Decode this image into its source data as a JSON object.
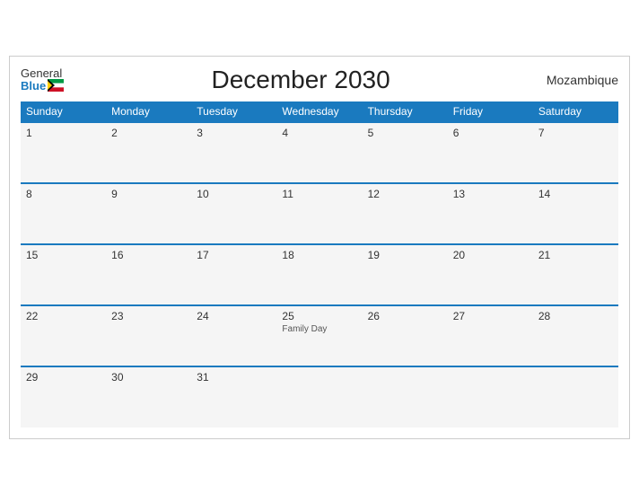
{
  "header": {
    "logo_general": "General",
    "logo_blue": "Blue",
    "title": "December 2030",
    "country": "Mozambique"
  },
  "weekdays": [
    "Sunday",
    "Monday",
    "Tuesday",
    "Wednesday",
    "Thursday",
    "Friday",
    "Saturday"
  ],
  "weeks": [
    [
      {
        "day": "1",
        "holiday": ""
      },
      {
        "day": "2",
        "holiday": ""
      },
      {
        "day": "3",
        "holiday": ""
      },
      {
        "day": "4",
        "holiday": ""
      },
      {
        "day": "5",
        "holiday": ""
      },
      {
        "day": "6",
        "holiday": ""
      },
      {
        "day": "7",
        "holiday": ""
      }
    ],
    [
      {
        "day": "8",
        "holiday": ""
      },
      {
        "day": "9",
        "holiday": ""
      },
      {
        "day": "10",
        "holiday": ""
      },
      {
        "day": "11",
        "holiday": ""
      },
      {
        "day": "12",
        "holiday": ""
      },
      {
        "day": "13",
        "holiday": ""
      },
      {
        "day": "14",
        "holiday": ""
      }
    ],
    [
      {
        "day": "15",
        "holiday": ""
      },
      {
        "day": "16",
        "holiday": ""
      },
      {
        "day": "17",
        "holiday": ""
      },
      {
        "day": "18",
        "holiday": ""
      },
      {
        "day": "19",
        "holiday": ""
      },
      {
        "day": "20",
        "holiday": ""
      },
      {
        "day": "21",
        "holiday": ""
      }
    ],
    [
      {
        "day": "22",
        "holiday": ""
      },
      {
        "day": "23",
        "holiday": ""
      },
      {
        "day": "24",
        "holiday": ""
      },
      {
        "day": "25",
        "holiday": "Family Day"
      },
      {
        "day": "26",
        "holiday": ""
      },
      {
        "day": "27",
        "holiday": ""
      },
      {
        "day": "28",
        "holiday": ""
      }
    ],
    [
      {
        "day": "29",
        "holiday": ""
      },
      {
        "day": "30",
        "holiday": ""
      },
      {
        "day": "31",
        "holiday": ""
      },
      {
        "day": "",
        "holiday": ""
      },
      {
        "day": "",
        "holiday": ""
      },
      {
        "day": "",
        "holiday": ""
      },
      {
        "day": "",
        "holiday": ""
      }
    ]
  ]
}
